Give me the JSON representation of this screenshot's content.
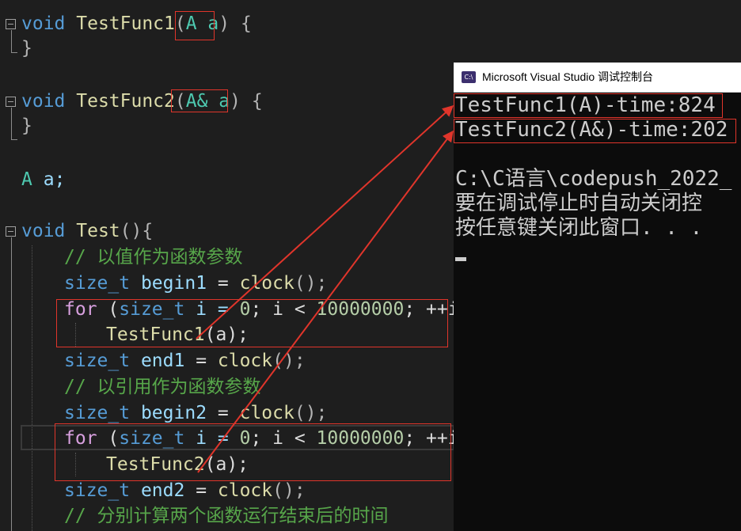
{
  "code": {
    "testfunc1": {
      "kw": "void",
      "name": "TestFunc1",
      "lp": "(",
      "param": "A a",
      "rp": ")",
      "brace": "{",
      "close": "}"
    },
    "testfunc2": {
      "kw": "void",
      "name": "TestFunc2",
      "lp": "(",
      "param": "A& a",
      "rp": ")",
      "brace": "{",
      "close": "}"
    },
    "global": {
      "type": "A",
      "var": "a;"
    },
    "test": {
      "kw": "void",
      "name": "Test",
      "paren": "()",
      "brace": "{"
    },
    "comment1": "// 以值作为函数参数",
    "begin1": {
      "type": "size_t",
      "name": "begin1",
      "eq": " = ",
      "call": "clock",
      "paren": "();"
    },
    "for1": {
      "kw": "for",
      "rest1": " (",
      "type": "size_t",
      "rest2": " i = ",
      "num1": "0",
      "rest3": "; i < ",
      "num2": "10000000",
      "rest4": "; ++i)"
    },
    "call1": {
      "fn": "TestFunc1",
      "args": "(a);"
    },
    "end1": {
      "type": "size_t",
      "name": "end1",
      "eq": " = ",
      "call": "clock",
      "paren": "();"
    },
    "comment2": "// 以引用作为函数参数",
    "begin2": {
      "type": "size_t",
      "name": "begin2",
      "eq": " = ",
      "call": "clock",
      "paren": "();"
    },
    "for2": {
      "kw": "for",
      "rest1": " (",
      "type": "size_t",
      "rest2": " i = ",
      "num1": "0",
      "rest3": "; i < ",
      "num2": "10000000",
      "rest4": "; ++i)"
    },
    "call2": {
      "fn": "TestFunc2",
      "args": "(a);"
    },
    "end2": {
      "type": "size_t",
      "name": "end2",
      "eq": " = ",
      "call": "clock",
      "paren": "();"
    },
    "comment3": "// 分别计算两个函数运行结束后的时间"
  },
  "console": {
    "title": "Microsoft Visual Studio 调试控制台",
    "icon_label": "C:\\",
    "lines": [
      "TestFunc1(A)-time:824",
      "TestFunc2(A&)-time:202",
      "",
      "C:\\C语言\\codepush_2022_",
      "要在调试停止时自动关闭控",
      "按任意键关闭此窗口. . ."
    ]
  },
  "colors": {
    "annotation": "#e0352b",
    "console_bg": "#0c0c0c",
    "editor_bg": "#1e1e1e"
  }
}
